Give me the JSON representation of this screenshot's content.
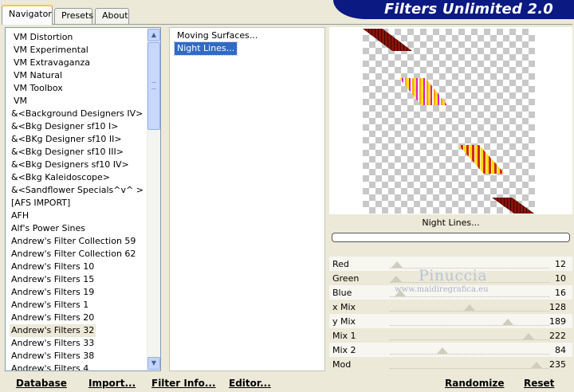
{
  "app": {
    "title": "Filters Unlimited 2.0",
    "tabs": [
      "Navigator",
      "Presets",
      "About"
    ]
  },
  "categories": {
    "items": [
      "VM Distortion",
      "VM Experimental",
      "VM Extravaganza",
      "VM Natural",
      "VM Toolbox",
      "VM",
      "&<Background Designers IV>",
      "&<Bkg Designer sf10 I>",
      "&<BKg Designer sf10 II>",
      "&<Bkg Designer sf10 III>",
      "&<Bkg Designers sf10 IV>",
      "&<Bkg Kaleidoscope>",
      "&<Sandflower Specials^v^ >",
      "[AFS IMPORT]",
      "AFH",
      "Alf's Power Sines",
      "Andrew's Filter Collection 59",
      "Andrew's Filter Collection 62",
      "Andrew's Filters 10",
      "Andrew's Filters 15",
      "Andrew's Filters 19",
      "Andrew's Filters 1",
      "Andrew's Filters 20",
      "Andrew's Filters 32",
      "Andrew's Filters 33",
      "Andrew's Filters 38",
      "Andrew's Filters 4"
    ],
    "selected": "Andrew's Filters 32"
  },
  "filters": {
    "items": [
      "Moving Surfaces...",
      "Night Lines..."
    ],
    "selected": "Night Lines..."
  },
  "preview": {
    "filter_name": "Night Lines...",
    "progress": 0
  },
  "sliders": [
    {
      "label": "Red",
      "value": 12
    },
    {
      "label": "Green",
      "value": 10
    },
    {
      "label": "Blue",
      "value": 16
    },
    {
      "label": "x Mix",
      "value": 128
    },
    {
      "label": "y Mix",
      "value": 189
    },
    {
      "label": "Mix 1",
      "value": 222
    },
    {
      "label": "Mix 2",
      "value": 84
    },
    {
      "label": "Mod",
      "value": 235
    }
  ],
  "watermark": {
    "name": "Pinuccia",
    "url": "www.maidiregrafica.eu"
  },
  "buttons": {
    "database": "Database",
    "import": "Import...",
    "filter_info": "Filter Info...",
    "editor": "Editor...",
    "randomize": "Randomize",
    "reset": "Reset"
  },
  "colors": {
    "banner": "#0a1a82",
    "selection": "#316ac5",
    "dark_red": "#8a1208",
    "red": "#d42a10",
    "yellow": "#ffe000",
    "magenta": "#e000c8"
  }
}
